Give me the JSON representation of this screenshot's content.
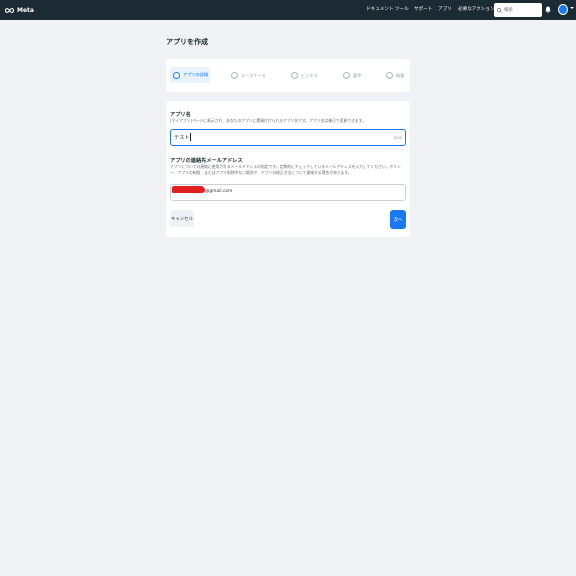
{
  "header": {
    "logo_text": "Meta",
    "nav": [
      "ドキュメント",
      "ツール",
      "サポート",
      "アプリ",
      "必要なアクション"
    ],
    "search_placeholder": "検索"
  },
  "page": {
    "title": "アプリを作成"
  },
  "steps": [
    {
      "label": "アプリの詳細",
      "active": true
    },
    {
      "label": "ユースケース",
      "active": false
    },
    {
      "label": "ビジネス",
      "active": false
    },
    {
      "label": "要件",
      "active": false
    },
    {
      "label": "概要",
      "active": false
    }
  ],
  "form": {
    "app_name": {
      "title": "アプリ名",
      "description": "[マイアプリ]ページに表示され、あなたのアプリに関連付けられるアプリ名です。アプリ名は後日で変更できます。",
      "value": "テスト",
      "counter": "3/30"
    },
    "email": {
      "title": "アプリの連絡先メールアドレス",
      "description": "アプリについての連絡に使用されるメールアドレスの指定です。定期的にチェックしているメールアドレスを入力してください。ポリシー、アプリの制限、またはアプリ削除中ない場合や、アプリの修正方法について連絡する場合があります。",
      "value": "@gmail.com"
    },
    "cancel_label": "キャンセル",
    "next_label": "次へ"
  },
  "colors": {
    "accent": "#1877f2",
    "topbar": "#1c2b33",
    "redaction": "#e1201f"
  }
}
